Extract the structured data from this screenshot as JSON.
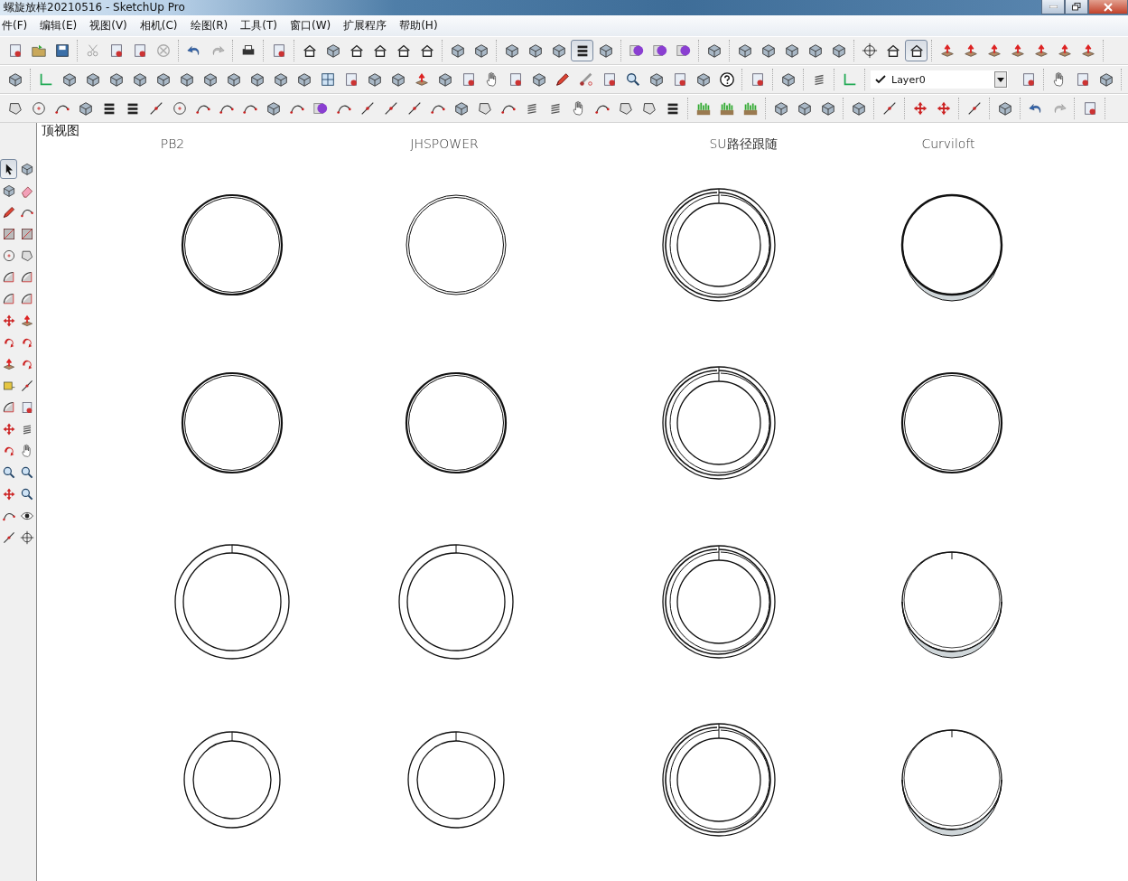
{
  "window": {
    "title": "螺旋放样20210516 - SketchUp Pro"
  },
  "menu": [
    "件(F)",
    "编辑(E)",
    "视图(V)",
    "相机(C)",
    "绘图(R)",
    "工具(T)",
    "窗口(W)",
    "扩展程序",
    "帮助(H)"
  ],
  "toolbars": [
    {
      "items": [
        {
          "kind": "group",
          "buttons": [
            {
              "kind": "page",
              "selected": false
            },
            {
              "kind": "folder",
              "selected": false
            },
            {
              "kind": "save",
              "selected": false
            }
          ]
        },
        {
          "kind": "group",
          "buttons": [
            {
              "kind": "scissors",
              "selected": false
            },
            {
              "kind": "page",
              "selected": false
            },
            {
              "kind": "page",
              "selected": false
            },
            {
              "kind": "circle-x",
              "selected": false
            }
          ]
        },
        {
          "kind": "group",
          "buttons": [
            {
              "kind": "undo",
              "selected": false
            },
            {
              "kind": "redo",
              "selected": false
            }
          ]
        },
        {
          "kind": "group",
          "buttons": [
            {
              "kind": "printer",
              "selected": false
            }
          ]
        },
        {
          "kind": "group",
          "buttons": [
            {
              "kind": "page",
              "selected": false
            }
          ]
        },
        {
          "kind": "group",
          "buttons": [
            {
              "kind": "house",
              "selected": false
            },
            {
              "kind": "cube",
              "selected": false
            },
            {
              "kind": "house",
              "selected": false
            },
            {
              "kind": "house",
              "selected": false
            },
            {
              "kind": "house",
              "selected": false
            },
            {
              "kind": "house",
              "selected": false
            }
          ]
        },
        {
          "kind": "group",
          "buttons": [
            {
              "kind": "cube",
              "selected": false
            },
            {
              "kind": "cube",
              "selected": false
            }
          ]
        },
        {
          "kind": "group",
          "buttons": [
            {
              "kind": "cube",
              "selected": false
            },
            {
              "kind": "cube",
              "selected": false
            },
            {
              "kind": "cube",
              "selected": false
            },
            {
              "kind": "stack",
              "selected": true
            },
            {
              "kind": "cube",
              "selected": false
            }
          ]
        },
        {
          "kind": "group",
          "buttons": [
            {
              "kind": "sphere",
              "selected": false
            },
            {
              "kind": "sphere",
              "selected": false
            },
            {
              "kind": "sphere",
              "selected": false
            }
          ]
        },
        {
          "kind": "group",
          "buttons": [
            {
              "kind": "cube",
              "selected": false
            }
          ]
        },
        {
          "kind": "group",
          "buttons": [
            {
              "kind": "cube",
              "selected": false
            },
            {
              "kind": "cube",
              "selected": false
            },
            {
              "kind": "cube",
              "selected": false
            },
            {
              "kind": "cube",
              "selected": false
            },
            {
              "kind": "cube",
              "selected": false
            }
          ]
        },
        {
          "kind": "group",
          "buttons": [
            {
              "kind": "target",
              "selected": false
            },
            {
              "kind": "house",
              "selected": false
            },
            {
              "kind": "house",
              "selected": true
            }
          ]
        },
        {
          "kind": "group",
          "buttons": [
            {
              "kind": "arrow-box",
              "selected": false
            },
            {
              "kind": "arrow-box",
              "selected": false
            },
            {
              "kind": "arrow-box",
              "selected": false
            },
            {
              "kind": "arrow-box",
              "selected": false
            },
            {
              "kind": "arrow-box",
              "selected": false
            },
            {
              "kind": "arrow-box",
              "selected": false
            },
            {
              "kind": "arrow-box",
              "selected": false
            }
          ]
        }
      ]
    },
    {
      "items": [
        {
          "kind": "group",
          "buttons": [
            {
              "kind": "cube",
              "selected": false
            }
          ]
        },
        {
          "kind": "group",
          "buttons": [
            {
              "kind": "axis",
              "selected": false
            },
            {
              "kind": "cube",
              "selected": false
            },
            {
              "kind": "cube",
              "selected": false
            },
            {
              "kind": "cube",
              "selected": false
            },
            {
              "kind": "cube",
              "selected": false
            },
            {
              "kind": "cube",
              "selected": false
            },
            {
              "kind": "cube",
              "selected": false
            },
            {
              "kind": "cube",
              "selected": false
            },
            {
              "kind": "cube",
              "selected": false
            },
            {
              "kind": "cube",
              "selected": false
            },
            {
              "kind": "cube",
              "selected": false
            },
            {
              "kind": "cube",
              "selected": false
            },
            {
              "kind": "grid",
              "selected": false
            },
            {
              "kind": "page",
              "selected": false
            },
            {
              "kind": "cube",
              "selected": false
            },
            {
              "kind": "cube",
              "selected": false
            },
            {
              "kind": "arrow-box",
              "selected": false
            },
            {
              "kind": "cube",
              "selected": false
            },
            {
              "kind": "page",
              "selected": false
            },
            {
              "kind": "hand",
              "selected": false
            },
            {
              "kind": "page",
              "selected": false
            },
            {
              "kind": "cube",
              "selected": false
            },
            {
              "kind": "pencil",
              "selected": false
            },
            {
              "kind": "tube",
              "selected": false
            },
            {
              "kind": "page",
              "selected": false
            },
            {
              "kind": "search",
              "selected": false
            },
            {
              "kind": "cube",
              "selected": false
            },
            {
              "kind": "page",
              "selected": false
            },
            {
              "kind": "cube",
              "selected": false
            },
            {
              "kind": "help",
              "selected": false
            }
          ]
        },
        {
          "kind": "group",
          "buttons": [
            {
              "kind": "page",
              "selected": false
            }
          ]
        },
        {
          "kind": "group",
          "buttons": [
            {
              "kind": "cube",
              "selected": false
            }
          ]
        },
        {
          "kind": "group",
          "buttons": [
            {
              "kind": "spring",
              "selected": false
            }
          ]
        },
        {
          "kind": "group",
          "buttons": [
            {
              "kind": "axis",
              "selected": false
            }
          ]
        },
        {
          "kind": "layer_select",
          "value": "Layer0"
        },
        {
          "kind": "group",
          "buttons": [
            {
              "kind": "page",
              "selected": false
            }
          ]
        },
        {
          "kind": "group",
          "buttons": [
            {
              "kind": "hand",
              "selected": false
            },
            {
              "kind": "page",
              "selected": false
            },
            {
              "kind": "cube",
              "selected": false
            }
          ]
        }
      ]
    },
    {
      "items": [
        {
          "kind": "group",
          "buttons": [
            {
              "kind": "polygon",
              "selected": false
            },
            {
              "kind": "circle",
              "selected": false
            },
            {
              "kind": "curve",
              "selected": false
            },
            {
              "kind": "cube",
              "selected": false
            },
            {
              "kind": "stack",
              "selected": false
            },
            {
              "kind": "stack",
              "selected": false
            },
            {
              "kind": "line",
              "selected": false
            },
            {
              "kind": "circle",
              "selected": false
            },
            {
              "kind": "curve",
              "selected": false
            },
            {
              "kind": "curve",
              "selected": false
            },
            {
              "kind": "curve",
              "selected": false
            },
            {
              "kind": "cube",
              "selected": false
            },
            {
              "kind": "curve",
              "selected": false
            },
            {
              "kind": "sphere",
              "selected": false
            },
            {
              "kind": "curve",
              "selected": false
            },
            {
              "kind": "line",
              "selected": false
            },
            {
              "kind": "line",
              "selected": false
            },
            {
              "kind": "line",
              "selected": false
            },
            {
              "kind": "curve",
              "selected": false
            },
            {
              "kind": "cube",
              "selected": false
            },
            {
              "kind": "polygon",
              "selected": false
            },
            {
              "kind": "curve",
              "selected": false
            },
            {
              "kind": "spring",
              "selected": false
            },
            {
              "kind": "spring",
              "selected": false
            },
            {
              "kind": "hand",
              "selected": false
            },
            {
              "kind": "curve",
              "selected": false
            },
            {
              "kind": "polygon",
              "selected": false
            },
            {
              "kind": "polygon",
              "selected": false
            },
            {
              "kind": "stack",
              "selected": false
            }
          ]
        },
        {
          "kind": "group",
          "buttons": [
            {
              "kind": "grass",
              "selected": false
            },
            {
              "kind": "grass",
              "selected": false
            },
            {
              "kind": "grass",
              "selected": false
            }
          ]
        },
        {
          "kind": "group",
          "buttons": [
            {
              "kind": "cube",
              "selected": false
            },
            {
              "kind": "cube",
              "selected": false
            },
            {
              "kind": "cube",
              "selected": false
            }
          ]
        },
        {
          "kind": "group",
          "buttons": [
            {
              "kind": "cube",
              "selected": false
            }
          ]
        },
        {
          "kind": "group",
          "buttons": [
            {
              "kind": "line",
              "selected": false
            }
          ]
        },
        {
          "kind": "group",
          "buttons": [
            {
              "kind": "move",
              "selected": false
            },
            {
              "kind": "move",
              "selected": false
            }
          ]
        },
        {
          "kind": "group",
          "buttons": [
            {
              "kind": "line",
              "selected": false
            }
          ]
        },
        {
          "kind": "group",
          "buttons": [
            {
              "kind": "cube",
              "selected": false
            }
          ]
        },
        {
          "kind": "group",
          "buttons": [
            {
              "kind": "undo",
              "selected": false
            },
            {
              "kind": "redo",
              "selected": false
            }
          ]
        },
        {
          "kind": "group",
          "buttons": [
            {
              "kind": "page",
              "selected": false
            }
          ]
        }
      ]
    }
  ],
  "left_toolbar": [
    [
      {
        "kind": "select",
        "selected": true
      },
      {
        "kind": "cube",
        "selected": false
      }
    ],
    [
      {
        "kind": "cube",
        "selected": false
      },
      {
        "kind": "eraser",
        "selected": false
      }
    ],
    [
      {
        "kind": "pencil",
        "selected": false
      },
      {
        "kind": "curve",
        "selected": false
      }
    ],
    [
      {
        "kind": "rectangle",
        "selected": false
      },
      {
        "kind": "rectangle",
        "selected": false
      }
    ],
    [
      {
        "kind": "circle",
        "selected": false
      },
      {
        "kind": "polygon",
        "selected": false
      }
    ],
    [
      {
        "kind": "arc",
        "selected": false
      },
      {
        "kind": "arc",
        "selected": false
      }
    ],
    [
      {
        "kind": "arc",
        "selected": false
      },
      {
        "kind": "arc",
        "selected": false
      }
    ],
    [
      {
        "kind": "move",
        "selected": false
      },
      {
        "kind": "arrow-box",
        "selected": false
      }
    ],
    [
      {
        "kind": "rotate",
        "selected": false
      },
      {
        "kind": "rotate",
        "selected": false
      }
    ],
    [
      {
        "kind": "arrow-box",
        "selected": false
      },
      {
        "kind": "rotate",
        "selected": false
      }
    ],
    [
      {
        "kind": "tape",
        "selected": false
      },
      {
        "kind": "line",
        "selected": false
      }
    ],
    [
      {
        "kind": "arc",
        "selected": false
      },
      {
        "kind": "page",
        "selected": false
      }
    ],
    [
      {
        "kind": "move",
        "selected": false
      },
      {
        "kind": "spring",
        "selected": false
      }
    ],
    [
      {
        "kind": "rotate",
        "selected": false
      },
      {
        "kind": "hand",
        "selected": false
      }
    ],
    [
      {
        "kind": "search",
        "selected": false
      },
      {
        "kind": "search",
        "selected": false
      }
    ],
    [
      {
        "kind": "move",
        "selected": false
      },
      {
        "kind": "search",
        "selected": false
      }
    ],
    [
      {
        "kind": "curve",
        "selected": false
      },
      {
        "kind": "eye",
        "selected": false
      }
    ],
    [
      {
        "kind": "line",
        "selected": false
      },
      {
        "kind": "target",
        "selected": false
      }
    ]
  ],
  "viewport": {
    "view_label": "顶视图",
    "columns": [
      {
        "label": "PB2",
        "rings": [
          {
            "kind": "double_bold"
          },
          {
            "kind": "double_bold"
          },
          {
            "kind": "band"
          },
          {
            "kind": "band_small"
          }
        ]
      },
      {
        "label": "JHSPOWER",
        "rings": [
          {
            "kind": "double_thin"
          },
          {
            "kind": "double_bold"
          },
          {
            "kind": "band"
          },
          {
            "kind": "band_small"
          }
        ]
      },
      {
        "label": "SU路径跟随",
        "rings": [
          {
            "kind": "spiral"
          },
          {
            "kind": "spiral"
          },
          {
            "kind": "spiral"
          },
          {
            "kind": "spiral"
          }
        ]
      },
      {
        "label": "Curviloft",
        "rings": [
          {
            "kind": "shaded"
          },
          {
            "kind": "double_bold"
          },
          {
            "kind": "shaded_band"
          },
          {
            "kind": "shaded_band"
          }
        ]
      }
    ]
  }
}
